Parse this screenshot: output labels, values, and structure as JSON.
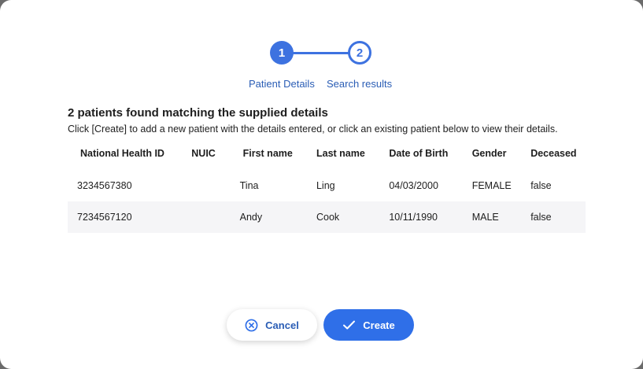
{
  "stepper": {
    "steps": [
      {
        "number": "1",
        "label": "Patient Details",
        "state": "complete"
      },
      {
        "number": "2",
        "label": "Search results",
        "state": "current"
      }
    ]
  },
  "results": {
    "title": "2 patients found matching the supplied details",
    "description": "Click [Create] to add a new patient with the details entered, or click an existing patient below to view their details."
  },
  "table": {
    "columns": [
      "National Health ID",
      "NUIC",
      "First name",
      "Last name",
      "Date of Birth",
      "Gender",
      "Deceased"
    ],
    "rows": [
      {
        "nhid": "3234567380",
        "nuic": "",
        "first": "Tina",
        "last": "Ling",
        "dob": "04/03/2000",
        "gender": "FEMALE",
        "deceased": "false"
      },
      {
        "nhid": "7234567120",
        "nuic": "",
        "first": "Andy",
        "last": "Cook",
        "dob": "10/11/1990",
        "gender": "MALE",
        "deceased": "false"
      }
    ]
  },
  "actions": {
    "cancel_label": "Cancel",
    "create_label": "Create"
  },
  "colors": {
    "accent": "#3d72e0",
    "primary_button": "#2f6fe8",
    "link_text": "#2a5db5",
    "row_stripe": "#f5f5f7"
  },
  "icons": {
    "cancel": "circle-x-icon",
    "create": "checkmark-icon"
  }
}
